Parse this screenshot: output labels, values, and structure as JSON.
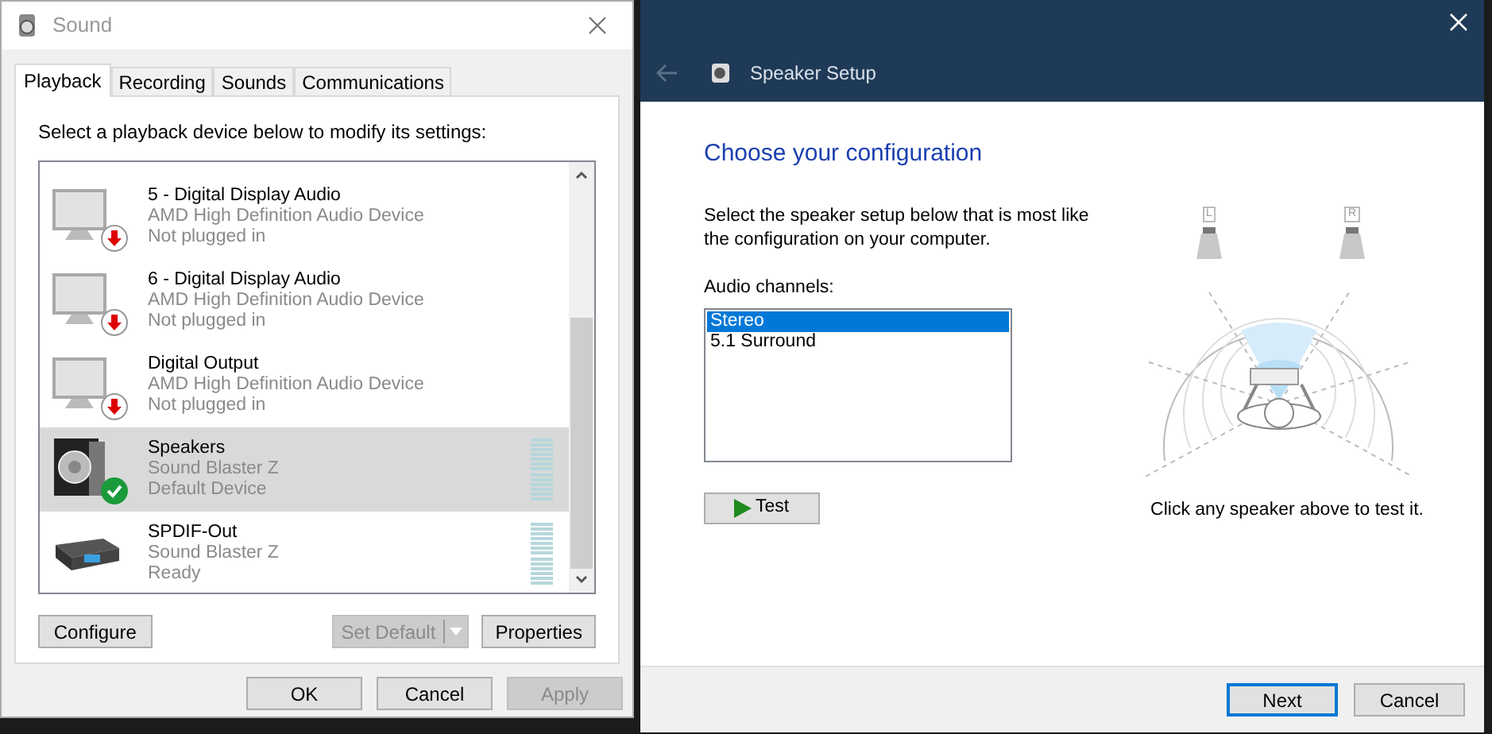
{
  "sound_window": {
    "title": "Sound",
    "tabs": [
      {
        "label": "Playback",
        "selected": true
      },
      {
        "label": "Recording",
        "selected": false
      },
      {
        "label": "Sounds",
        "selected": false
      },
      {
        "label": "Communications",
        "selected": false
      }
    ],
    "instruction": "Select a playback device below to modify its settings:",
    "devices": [
      {
        "name": "5 - Digital Display Audio",
        "driver": "AMD High Definition Audio Device",
        "status": "Not plugged in",
        "kind": "monitor",
        "unplugged": true,
        "default": false,
        "meter": false,
        "selected": false
      },
      {
        "name": "6 - Digital Display Audio",
        "driver": "AMD High Definition Audio Device",
        "status": "Not plugged in",
        "kind": "monitor",
        "unplugged": true,
        "default": false,
        "meter": false,
        "selected": false
      },
      {
        "name": "Digital Output",
        "driver": "AMD High Definition Audio Device",
        "status": "Not plugged in",
        "kind": "monitor",
        "unplugged": true,
        "default": false,
        "meter": false,
        "selected": false
      },
      {
        "name": "Speakers",
        "driver": "Sound Blaster Z",
        "status": "Default Device",
        "kind": "speaker",
        "unplugged": false,
        "default": true,
        "meter": true,
        "selected": true
      },
      {
        "name": "SPDIF-Out",
        "driver": "Sound Blaster Z",
        "status": "Ready",
        "kind": "receiver",
        "unplugged": false,
        "default": false,
        "meter": true,
        "selected": false
      }
    ],
    "actions": [
      {
        "label": "Configure",
        "disabled": false
      },
      {
        "label": "Set Default",
        "disabled": true
      },
      {
        "label": "Properties",
        "disabled": false
      }
    ],
    "buttons": [
      {
        "label": "OK",
        "disabled": false
      },
      {
        "label": "Cancel",
        "disabled": false
      },
      {
        "label": "Apply",
        "disabled": true
      }
    ]
  },
  "setup_window": {
    "title": "Speaker Setup",
    "heading": "Choose your configuration",
    "instruction": "Select the speaker setup below that is most like the configuration on your computer.",
    "channels_label": "Audio channels:",
    "channels": [
      {
        "label": "Stereo",
        "selected": true
      },
      {
        "label": "5.1 Surround",
        "selected": false
      }
    ],
    "test_button": "Test",
    "speakers": [
      {
        "label": "L"
      },
      {
        "label": "R"
      }
    ],
    "hint": "Click any speaker above to test it.",
    "buttons": [
      {
        "label": "Next",
        "default": true
      },
      {
        "label": "Cancel",
        "default": false
      }
    ]
  }
}
